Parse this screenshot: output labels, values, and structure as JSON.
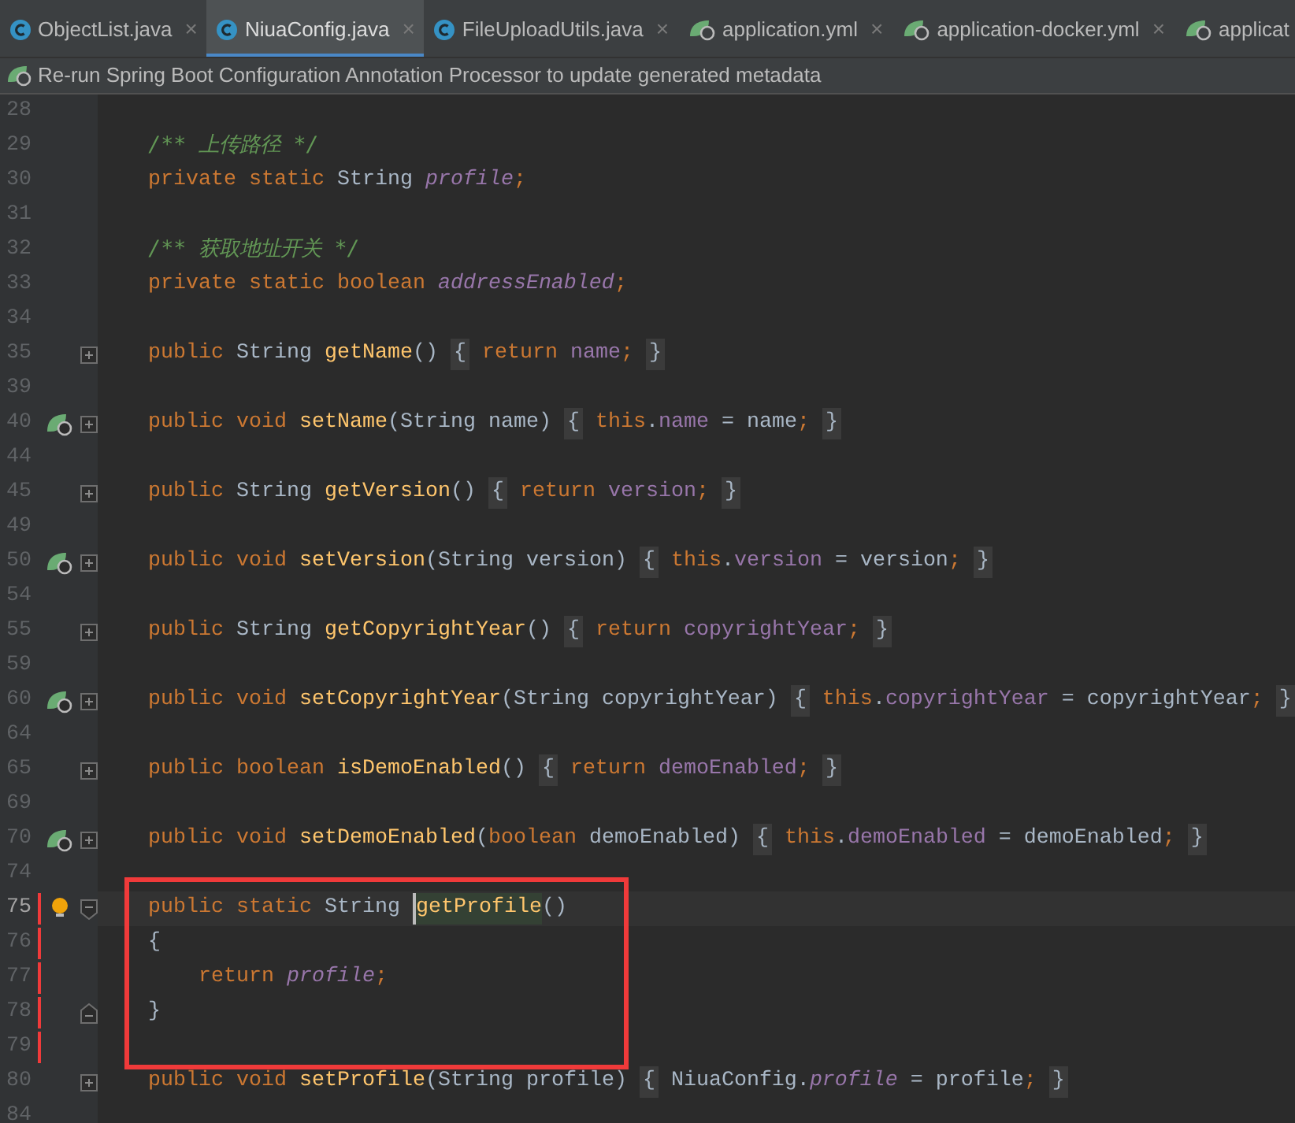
{
  "tabs": [
    {
      "label": "ObjectList.java",
      "kind": "class",
      "selected": false,
      "closable": true
    },
    {
      "label": "NiuaConfig.java",
      "kind": "class",
      "selected": true,
      "closable": true
    },
    {
      "label": "FileUploadUtils.java",
      "kind": "class",
      "selected": false,
      "closable": true
    },
    {
      "label": "application.yml",
      "kind": "spring",
      "selected": false,
      "closable": true
    },
    {
      "label": "application-docker.yml",
      "kind": "spring",
      "selected": false,
      "closable": true
    },
    {
      "label": "applicat",
      "kind": "spring",
      "selected": false,
      "closable": false
    }
  ],
  "close_glyph": "×",
  "banner": {
    "text": "Re-run Spring Boot Configuration Annotation Processor to update generated metadata"
  },
  "lines": [
    {
      "number": "28",
      "current": false,
      "boxed": false
    },
    {
      "number": "29",
      "tokens": [
        {
          "text": "    /** 上传路径 */",
          "kind": "comment"
        }
      ],
      "current": false,
      "boxed": false
    },
    {
      "number": "30",
      "tokens": [
        {
          "text": "    private static ",
          "kind": "keyword"
        },
        {
          "text": "String ",
          "kind": "plain"
        },
        {
          "text": "profile",
          "kind": "static-field"
        },
        {
          "text": ";",
          "kind": "keyword"
        }
      ],
      "current": false,
      "boxed": false
    },
    {
      "number": "31",
      "current": false,
      "boxed": false
    },
    {
      "number": "32",
      "tokens": [
        {
          "text": "    /** 获取地址开关 */",
          "kind": "comment"
        }
      ],
      "current": false,
      "boxed": false
    },
    {
      "number": "33",
      "tokens": [
        {
          "text": "    private static boolean ",
          "kind": "keyword"
        },
        {
          "text": "addressEnabled",
          "kind": "static-field"
        },
        {
          "text": ";",
          "kind": "keyword"
        }
      ],
      "current": false,
      "boxed": false
    },
    {
      "number": "34",
      "current": false,
      "boxed": false
    },
    {
      "number": "35",
      "tokens": [
        {
          "text": "    public ",
          "kind": "keyword"
        },
        {
          "text": "String ",
          "kind": "plain"
        },
        {
          "text": "getName",
          "kind": "method"
        },
        {
          "text": "() ",
          "kind": "plain"
        },
        {
          "text": "{",
          "kind": "folded"
        },
        {
          "text": " return ",
          "kind": "keyword"
        },
        {
          "text": "name",
          "kind": "field"
        },
        {
          "text": "; ",
          "kind": "keyword"
        },
        {
          "text": "}",
          "kind": "folded"
        }
      ],
      "gutter_icons": [
        {
          "kind": "fold-plus"
        }
      ],
      "current": false,
      "boxed": false
    },
    {
      "number": "39",
      "current": false,
      "boxed": false
    },
    {
      "number": "40",
      "tokens": [
        {
          "text": "    public void ",
          "kind": "keyword"
        },
        {
          "text": "setName",
          "kind": "method"
        },
        {
          "text": "(String name) ",
          "kind": "plain"
        },
        {
          "text": "{",
          "kind": "folded"
        },
        {
          "text": " this",
          "kind": "keyword"
        },
        {
          "text": ".",
          "kind": "plain"
        },
        {
          "text": "name",
          "kind": "field"
        },
        {
          "text": " = name",
          "kind": "plain"
        },
        {
          "text": "; ",
          "kind": "keyword"
        },
        {
          "text": "}",
          "kind": "folded"
        }
      ],
      "gutter_icons": [
        {
          "kind": "bean"
        },
        {
          "kind": "fold-plus"
        }
      ],
      "current": false,
      "boxed": false
    },
    {
      "number": "44",
      "current": false,
      "boxed": false
    },
    {
      "number": "45",
      "tokens": [
        {
          "text": "    public ",
          "kind": "keyword"
        },
        {
          "text": "String ",
          "kind": "plain"
        },
        {
          "text": "getVersion",
          "kind": "method"
        },
        {
          "text": "() ",
          "kind": "plain"
        },
        {
          "text": "{",
          "kind": "folded"
        },
        {
          "text": " return ",
          "kind": "keyword"
        },
        {
          "text": "version",
          "kind": "field"
        },
        {
          "text": "; ",
          "kind": "keyword"
        },
        {
          "text": "}",
          "kind": "folded"
        }
      ],
      "gutter_icons": [
        {
          "kind": "fold-plus"
        }
      ],
      "current": false,
      "boxed": false
    },
    {
      "number": "49",
      "current": false,
      "boxed": false
    },
    {
      "number": "50",
      "tokens": [
        {
          "text": "    public void ",
          "kind": "keyword"
        },
        {
          "text": "setVersion",
          "kind": "method"
        },
        {
          "text": "(String version) ",
          "kind": "plain"
        },
        {
          "text": "{",
          "kind": "folded"
        },
        {
          "text": " this",
          "kind": "keyword"
        },
        {
          "text": ".",
          "kind": "plain"
        },
        {
          "text": "version",
          "kind": "field"
        },
        {
          "text": " = version",
          "kind": "plain"
        },
        {
          "text": "; ",
          "kind": "keyword"
        },
        {
          "text": "}",
          "kind": "folded"
        }
      ],
      "gutter_icons": [
        {
          "kind": "bean"
        },
        {
          "kind": "fold-plus"
        }
      ],
      "current": false,
      "boxed": false
    },
    {
      "number": "54",
      "current": false,
      "boxed": false
    },
    {
      "number": "55",
      "tokens": [
        {
          "text": "    public ",
          "kind": "keyword"
        },
        {
          "text": "String ",
          "kind": "plain"
        },
        {
          "text": "getCopyrightYear",
          "kind": "method"
        },
        {
          "text": "() ",
          "kind": "plain"
        },
        {
          "text": "{",
          "kind": "folded"
        },
        {
          "text": " return ",
          "kind": "keyword"
        },
        {
          "text": "copyrightYear",
          "kind": "field"
        },
        {
          "text": "; ",
          "kind": "keyword"
        },
        {
          "text": "}",
          "kind": "folded"
        }
      ],
      "gutter_icons": [
        {
          "kind": "fold-plus"
        }
      ],
      "current": false,
      "boxed": false
    },
    {
      "number": "59",
      "current": false,
      "boxed": false
    },
    {
      "number": "60",
      "tokens": [
        {
          "text": "    public void ",
          "kind": "keyword"
        },
        {
          "text": "setCopyrightYear",
          "kind": "method"
        },
        {
          "text": "(String copyrightYear) ",
          "kind": "plain"
        },
        {
          "text": "{",
          "kind": "folded"
        },
        {
          "text": " this",
          "kind": "keyword"
        },
        {
          "text": ".",
          "kind": "plain"
        },
        {
          "text": "copyrightYear",
          "kind": "field"
        },
        {
          "text": " = copyrightYear",
          "kind": "plain"
        },
        {
          "text": "; ",
          "kind": "keyword"
        },
        {
          "text": "}",
          "kind": "folded"
        }
      ],
      "gutter_icons": [
        {
          "kind": "bean"
        },
        {
          "kind": "fold-plus"
        }
      ],
      "current": false,
      "boxed": false
    },
    {
      "number": "64",
      "current": false,
      "boxed": false
    },
    {
      "number": "65",
      "tokens": [
        {
          "text": "    public boolean ",
          "kind": "keyword"
        },
        {
          "text": "isDemoEnabled",
          "kind": "method"
        },
        {
          "text": "() ",
          "kind": "plain"
        },
        {
          "text": "{",
          "kind": "folded"
        },
        {
          "text": " return ",
          "kind": "keyword"
        },
        {
          "text": "demoEnabled",
          "kind": "field"
        },
        {
          "text": "; ",
          "kind": "keyword"
        },
        {
          "text": "}",
          "kind": "folded"
        }
      ],
      "gutter_icons": [
        {
          "kind": "fold-plus"
        }
      ],
      "current": false,
      "boxed": false
    },
    {
      "number": "69",
      "current": false,
      "boxed": false
    },
    {
      "number": "70",
      "tokens": [
        {
          "text": "    public void ",
          "kind": "keyword"
        },
        {
          "text": "setDemoEnabled",
          "kind": "method"
        },
        {
          "text": "(",
          "kind": "plain"
        },
        {
          "text": "boolean ",
          "kind": "keyword"
        },
        {
          "text": "demoEnabled) ",
          "kind": "plain"
        },
        {
          "text": "{",
          "kind": "folded"
        },
        {
          "text": " this",
          "kind": "keyword"
        },
        {
          "text": ".",
          "kind": "plain"
        },
        {
          "text": "demoEnabled",
          "kind": "field"
        },
        {
          "text": " = demoEnabled",
          "kind": "plain"
        },
        {
          "text": "; ",
          "kind": "keyword"
        },
        {
          "text": "}",
          "kind": "folded"
        }
      ],
      "gutter_icons": [
        {
          "kind": "bean"
        },
        {
          "kind": "fold-plus"
        }
      ],
      "current": false,
      "boxed": false
    },
    {
      "number": "74",
      "current": false,
      "boxed": false
    },
    {
      "number": "75",
      "tokens": [
        {
          "text": "    public static ",
          "kind": "keyword"
        },
        {
          "text": "String ",
          "kind": "plain"
        },
        {
          "text": "getProfile",
          "kind": "method-usage"
        },
        {
          "text": "()",
          "kind": "plain"
        }
      ],
      "gutter_icons": [
        {
          "kind": "bulb"
        },
        {
          "kind": "fold-minus"
        }
      ],
      "current": true,
      "boxed": true
    },
    {
      "number": "76",
      "tokens": [
        {
          "text": "    {",
          "kind": "plain"
        }
      ],
      "current": false,
      "boxed": true
    },
    {
      "number": "77",
      "tokens": [
        {
          "text": "        return ",
          "kind": "keyword"
        },
        {
          "text": "profile",
          "kind": "static-field"
        },
        {
          "text": ";",
          "kind": "keyword"
        }
      ],
      "current": false,
      "boxed": true
    },
    {
      "number": "78",
      "tokens": [
        {
          "text": "    }",
          "kind": "plain"
        }
      ],
      "gutter_icons": [
        {
          "kind": "fold-end"
        }
      ],
      "current": false,
      "boxed": true
    },
    {
      "number": "79",
      "current": false,
      "boxed": true
    },
    {
      "number": "80",
      "tokens": [
        {
          "text": "    public void ",
          "kind": "keyword"
        },
        {
          "text": "setProfile",
          "kind": "method"
        },
        {
          "text": "(String profile) ",
          "kind": "plain"
        },
        {
          "text": "{",
          "kind": "folded"
        },
        {
          "text": " NiuaConfig.",
          "kind": "plain"
        },
        {
          "text": "profile",
          "kind": "static-field"
        },
        {
          "text": " = profile",
          "kind": "plain"
        },
        {
          "text": "; ",
          "kind": "keyword"
        },
        {
          "text": "}",
          "kind": "folded"
        }
      ],
      "gutter_icons": [
        {
          "kind": "fold-plus"
        }
      ],
      "current": false,
      "boxed": false
    },
    {
      "number": "84",
      "current": false,
      "boxed": false
    }
  ]
}
